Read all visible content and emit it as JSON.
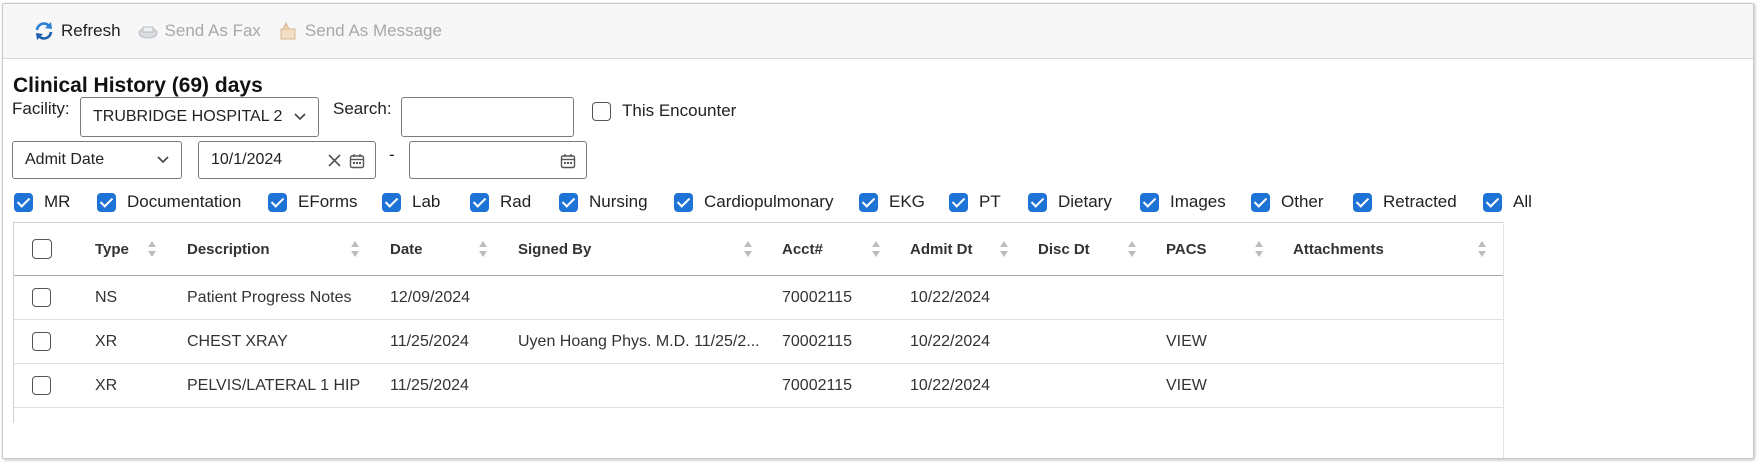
{
  "toolbar": {
    "refresh": "Refresh",
    "send_fax": "Send As Fax",
    "send_message": "Send As Message"
  },
  "title": "Clinical History (69) days",
  "facility": {
    "label": "Facility:",
    "value": "TRUBRIDGE HOSPITAL 2"
  },
  "search": {
    "label": "Search:",
    "value": ""
  },
  "this_encounter": {
    "label": "This Encounter",
    "checked": false
  },
  "date_type": {
    "value": "Admit Date"
  },
  "date_from": {
    "value": "10/1/2024"
  },
  "date_separator": "-",
  "date_to": {
    "value": ""
  },
  "filters": [
    {
      "label": "MR",
      "checked": true
    },
    {
      "label": "Documentation",
      "checked": true
    },
    {
      "label": "EForms",
      "checked": true
    },
    {
      "label": "Lab",
      "checked": true
    },
    {
      "label": "Rad",
      "checked": true
    },
    {
      "label": "Nursing",
      "checked": true
    },
    {
      "label": "Cardiopulmonary",
      "checked": true
    },
    {
      "label": "EKG",
      "checked": true
    },
    {
      "label": "PT",
      "checked": true
    },
    {
      "label": "Dietary",
      "checked": true
    },
    {
      "label": "Images",
      "checked": true
    },
    {
      "label": "Other",
      "checked": true
    },
    {
      "label": "Retracted",
      "checked": true
    },
    {
      "label": "All",
      "checked": true
    }
  ],
  "table": {
    "columns": [
      "Type",
      "Description",
      "Date",
      "Signed By",
      "Acct#",
      "Admit Dt",
      "Disc Dt",
      "PACS",
      "Attachments"
    ],
    "rows": [
      {
        "type": "NS",
        "description": "Patient Progress Notes",
        "date": "12/09/2024",
        "signed_by": "",
        "acct": "70002115",
        "admit_dt": "10/22/2024",
        "disc_dt": "",
        "pacs": "",
        "attachments": ""
      },
      {
        "type": "XR",
        "description": "CHEST XRAY",
        "date": "11/25/2024",
        "signed_by": "Uyen Hoang Phys. M.D. 11/25/2...",
        "acct": "70002115",
        "admit_dt": "10/22/2024",
        "disc_dt": "",
        "pacs": "VIEW",
        "attachments": ""
      },
      {
        "type": "XR",
        "description": "PELVIS/LATERAL 1 HIP",
        "date": "11/25/2024",
        "signed_by": "",
        "acct": "70002115",
        "admit_dt": "10/22/2024",
        "disc_dt": "",
        "pacs": "VIEW",
        "attachments": ""
      }
    ]
  },
  "colors": {
    "accent": "#1e73d6",
    "disabled_text": "#a8a8a8",
    "toolbar_bg": "#f7f7f7"
  },
  "icons": {
    "refresh": "refresh-icon",
    "fax": "fax-icon",
    "message": "message-icon",
    "calendar": "calendar-icon",
    "clear": "clear-icon",
    "dropdown": "chevron-down-icon",
    "sort": "sort-icon"
  }
}
